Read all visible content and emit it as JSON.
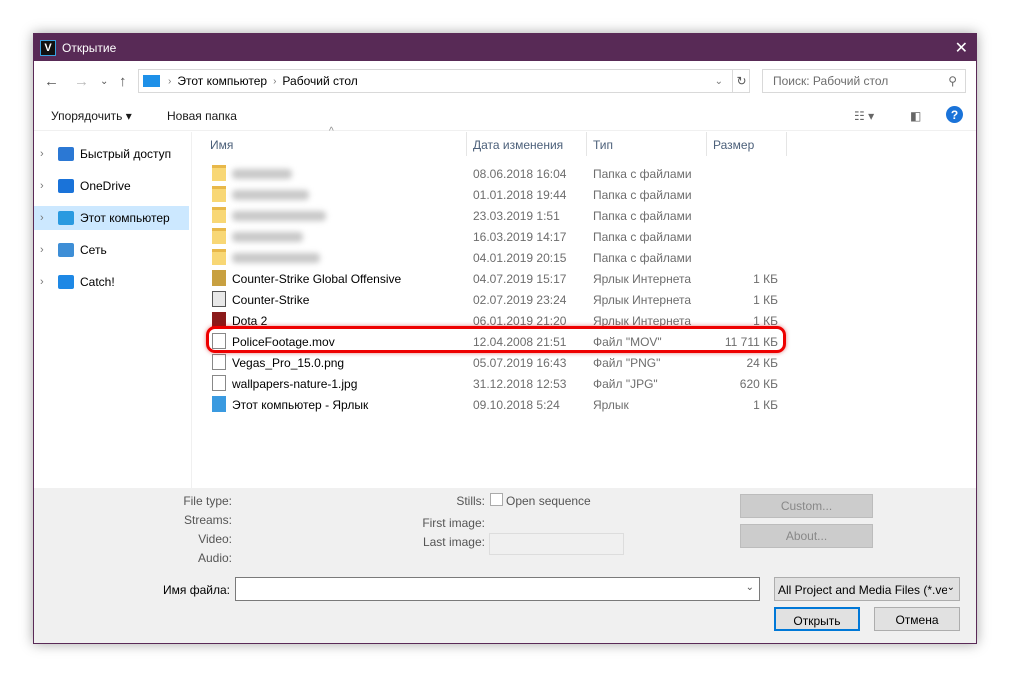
{
  "window": {
    "title": "Открытие",
    "close_icon": "close-icon"
  },
  "nav": {
    "breadcrumb": [
      "Этот компьютер",
      "Рабочий стол"
    ],
    "search_placeholder": "Поиск: Рабочий стол"
  },
  "toolbar": {
    "organize": "Упорядочить",
    "new_folder": "Новая папка"
  },
  "sidebar": {
    "items": [
      {
        "label": "Быстрый доступ",
        "icon": "star-icon",
        "color": "#2b78d4"
      },
      {
        "label": "OneDrive",
        "icon": "cloud-icon",
        "color": "#1a73d9"
      },
      {
        "label": "Этот компьютер",
        "icon": "computer-icon",
        "color": "#2a9ae0",
        "selected": true
      },
      {
        "label": "Сеть",
        "icon": "network-icon",
        "color": "#3e8ed6"
      },
      {
        "label": "Catch!",
        "icon": "catch-icon",
        "color": "#1e88e5"
      }
    ]
  },
  "columns": {
    "name": "Имя",
    "date": "Дата изменения",
    "type": "Тип",
    "size": "Размер"
  },
  "files": [
    {
      "name": "",
      "blurred": true,
      "date": "08.06.2018 16:04",
      "type": "Папка с файлами",
      "size": "",
      "icon": "folder-icon"
    },
    {
      "name": "",
      "blurred": true,
      "date": "01.01.2018 19:44",
      "type": "Папка с файлами",
      "size": "",
      "icon": "folder-icon"
    },
    {
      "name": "",
      "blurred": true,
      "date": "23.03.2019 1:51",
      "type": "Папка с файлами",
      "size": "",
      "icon": "folder-icon"
    },
    {
      "name": "",
      "blurred": true,
      "date": "16.03.2019 14:17",
      "type": "Папка с файлами",
      "size": "",
      "icon": "folder-icon"
    },
    {
      "name": "",
      "blurred": true,
      "date": "04.01.2019 20:15",
      "type": "Папка с файлами",
      "size": "",
      "icon": "folder-icon"
    },
    {
      "name": "Counter-Strike Global Offensive",
      "date": "04.07.2019 15:17",
      "type": "Ярлык Интернета",
      "size": "1 КБ",
      "icon": "csgo-icon"
    },
    {
      "name": "Counter-Strike",
      "date": "02.07.2019 23:24",
      "type": "Ярлык Интернета",
      "size": "1 КБ",
      "icon": "cs-icon"
    },
    {
      "name": "Dota 2",
      "date": "06.01.2019 21:20",
      "type": "Ярлык Интернета",
      "size": "1 КБ",
      "icon": "dota-icon"
    },
    {
      "name": "PoliceFootage.mov",
      "date": "12.04.2008 21:51",
      "type": "Файл \"MOV\"",
      "size": "11 711 КБ",
      "icon": "video-file-icon",
      "highlighted": true
    },
    {
      "name": "Vegas_Pro_15.0.png",
      "date": "05.07.2019 16:43",
      "type": "Файл \"PNG\"",
      "size": "24 КБ",
      "icon": "image-file-icon"
    },
    {
      "name": "wallpapers-nature-1.jpg",
      "date": "31.12.2018 12:53",
      "type": "Файл \"JPG\"",
      "size": "620 КБ",
      "icon": "image-file-icon"
    },
    {
      "name": "Этот компьютер - Ярлык",
      "date": "09.10.2018 5:24",
      "type": "Ярлык",
      "size": "1 КБ",
      "icon": "computer-shortcut-icon"
    }
  ],
  "info": {
    "file_type": "File type:",
    "streams": "Streams:",
    "video": "Video:",
    "audio": "Audio:",
    "stills": "Stills:",
    "open_sequence": "Open sequence",
    "first_image": "First image:",
    "last_image": "Last image:",
    "custom": "Custom...",
    "about": "About..."
  },
  "footer": {
    "filename_label": "Имя файла:",
    "filename_value": "",
    "filter": "All Project and Media Files (*.ve",
    "open": "Открыть",
    "cancel": "Отмена"
  }
}
